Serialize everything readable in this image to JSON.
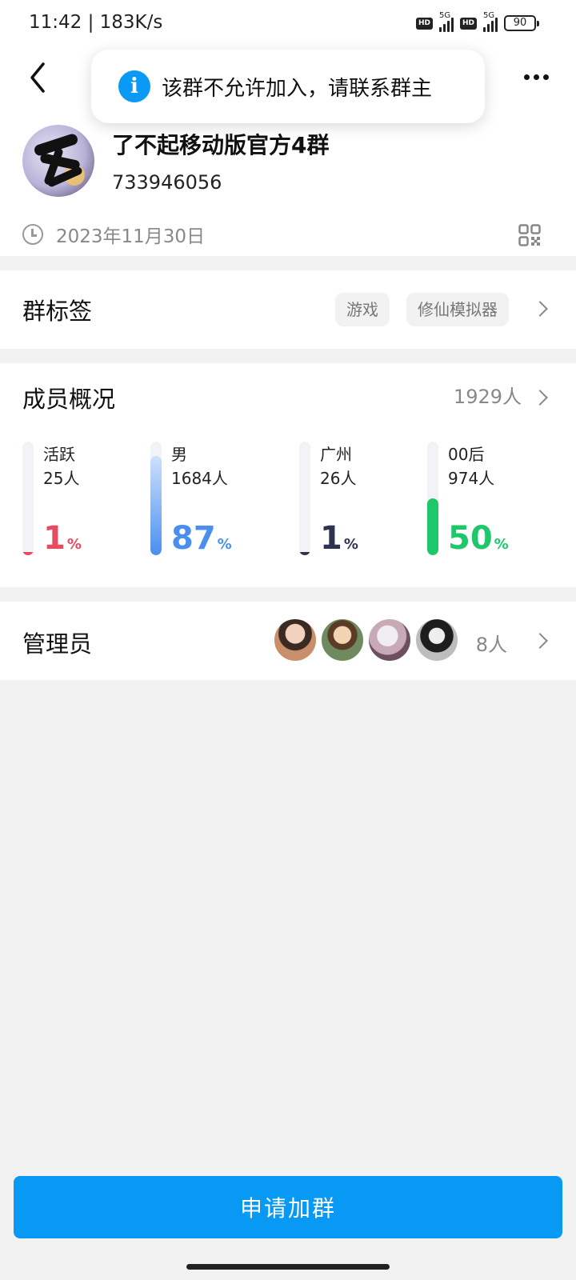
{
  "status_bar": {
    "time": "11:42 | 183K/s",
    "sim1_label": "5G",
    "sim2_label": "5G",
    "hd1": "HD",
    "hd2": "HD",
    "battery": "90"
  },
  "toast": {
    "icon": "i",
    "message": "该群不允许加入，请联系群主"
  },
  "group": {
    "name": "了不起移动版官方4群",
    "id": "733946056",
    "created_date": "2023年11月30日"
  },
  "tags_section": {
    "title": "群标签",
    "tags": [
      "游戏",
      "修仙模拟器"
    ]
  },
  "members_section": {
    "title": "成员概况",
    "count": "1929人",
    "stats": [
      {
        "label": "活跃",
        "count": "25人",
        "percent": "1",
        "unit": "%",
        "fill": 0.01,
        "color": "#e84a5f"
      },
      {
        "label": "男",
        "count": "1684人",
        "percent": "87",
        "unit": "%",
        "fill": 0.87,
        "color": "#4a8ff0"
      },
      {
        "label": "广州",
        "count": "26人",
        "percent": "1",
        "unit": "%",
        "fill": 0.01,
        "color": "#2d3350"
      },
      {
        "label": "00后",
        "count": "974人",
        "percent": "50",
        "unit": "%",
        "fill": 0.5,
        "color": "#1ec86a"
      }
    ]
  },
  "admins_section": {
    "title": "管理员",
    "count": "8人"
  },
  "join_button": {
    "label": "申请加群",
    "color": "#0899f5"
  }
}
